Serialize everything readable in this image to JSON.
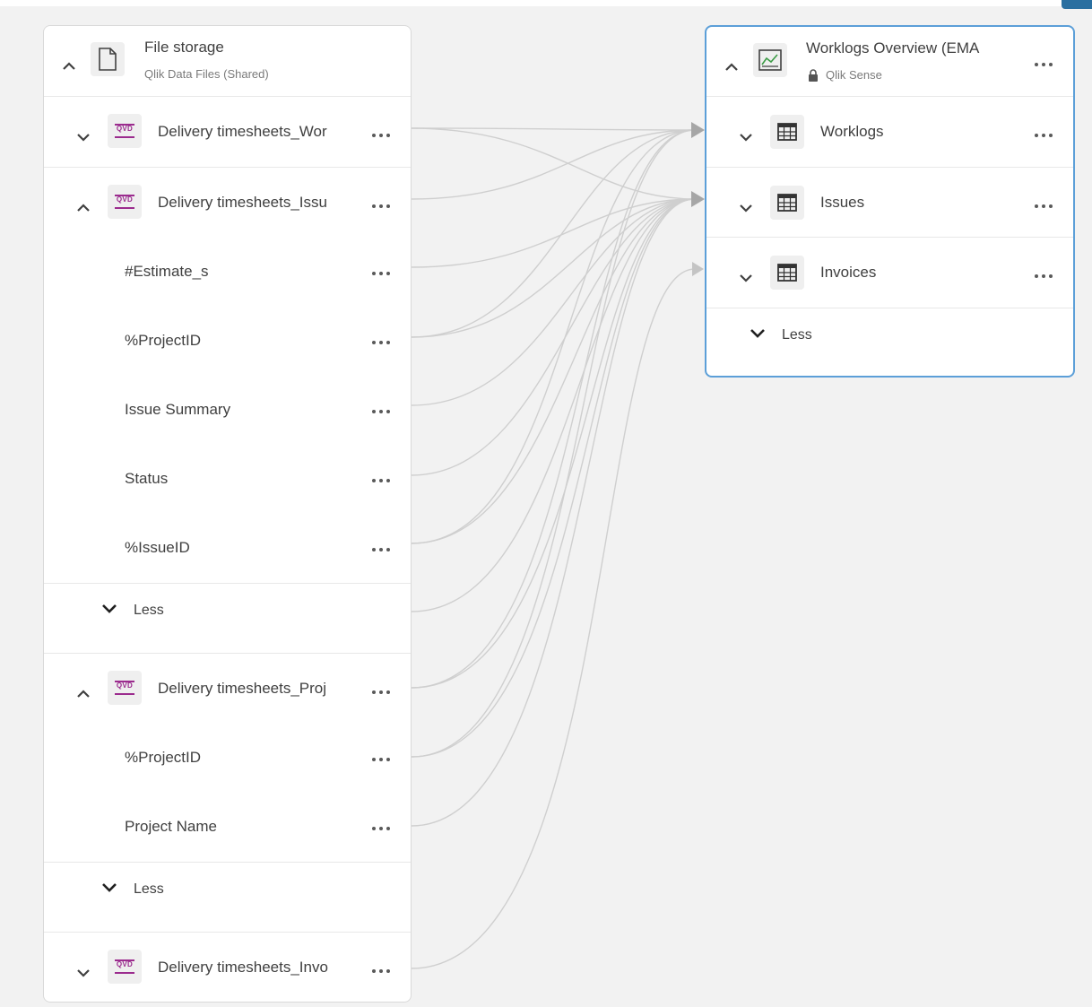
{
  "source": {
    "title": "File storage",
    "subtitle": "Qlik Data Files (Shared)",
    "icon": "file-icon",
    "items": [
      {
        "name": "Delivery timesheets_Wor",
        "icon": "qvd-icon",
        "icon_text": "QVD",
        "expanded": false
      },
      {
        "name": "Delivery timesheets_Issu",
        "icon": "qvd-icon",
        "icon_text": "QVD",
        "expanded": true,
        "fields": [
          "#Estimate_s",
          "%ProjectID",
          "Issue Summary",
          "Status",
          "%IssueID"
        ],
        "less_label": "Less"
      },
      {
        "name": "Delivery timesheets_Proj",
        "icon": "qvd-icon",
        "icon_text": "QVD",
        "expanded": true,
        "fields": [
          "%ProjectID",
          "Project Name"
        ],
        "less_label": "Less"
      },
      {
        "name": "Delivery timesheets_Invo",
        "icon": "qvd-icon",
        "icon_text": "QVD",
        "expanded": false
      }
    ]
  },
  "target": {
    "title": "Worklogs Overview (EMA",
    "subtitle": "Qlik Sense",
    "icon": "app-chart-icon",
    "lock_icon": "lock-icon",
    "tables": [
      {
        "name": "Worklogs",
        "icon": "table-icon"
      },
      {
        "name": "Issues",
        "icon": "table-icon"
      },
      {
        "name": "Invoices",
        "icon": "table-icon"
      }
    ],
    "less_label": "Less"
  },
  "colors": {
    "accent_border": "#5c9fd8",
    "qvd": "#9b2c8e",
    "link": "#c8c8c8",
    "arrow": "#a6a6a6"
  }
}
